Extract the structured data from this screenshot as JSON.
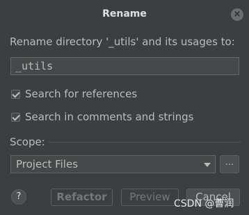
{
  "dialog": {
    "title": "Rename",
    "close_icon": "close-icon",
    "prompt": "Rename directory '_utils' and its usages to:",
    "name_value": "_utils"
  },
  "options": {
    "search_references": {
      "label": "Search for references",
      "checked": true
    },
    "search_comments": {
      "label": "Search in comments and strings",
      "checked": true
    }
  },
  "scope": {
    "label": "Scope:",
    "selected": "Project Files",
    "more_label": "..."
  },
  "buttons": {
    "help": "?",
    "refactor": "Refactor",
    "preview": "Preview",
    "cancel": "Cancel"
  },
  "watermark": "CSDN @曹润"
}
